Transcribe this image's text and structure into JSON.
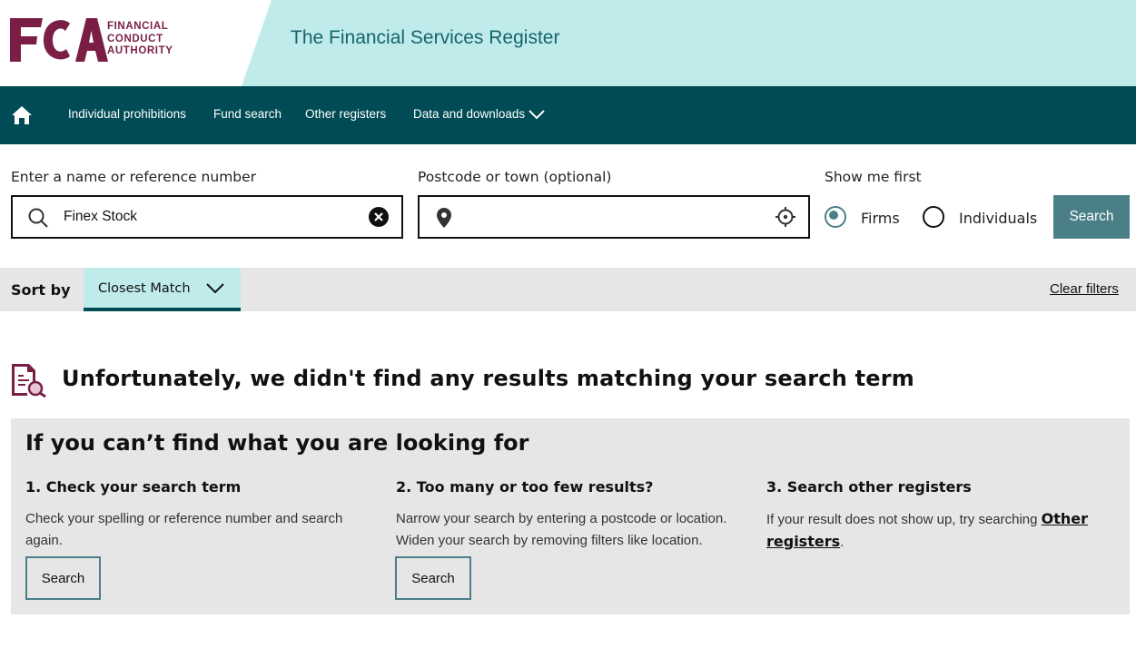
{
  "header": {
    "logo_letters": "FCA",
    "logo_line1": "FINANCIAL",
    "logo_line2": "CONDUCT",
    "logo_line3": "AUTHORITY",
    "title": "The Financial Services Register"
  },
  "nav": {
    "home_icon": "home-icon",
    "items": [
      {
        "label": "Individual prohibitions"
      },
      {
        "label": "Fund search"
      },
      {
        "label": "Other registers"
      },
      {
        "label": "Data and downloads"
      }
    ]
  },
  "search": {
    "name_label": "Enter a name or reference number",
    "name_value": "Finex Stock",
    "location_label": "Postcode or town (optional)",
    "location_value": "",
    "show_first_label": "Show me first",
    "option_firms": "Firms",
    "option_individuals": "Individuals",
    "selected_option": "Firms",
    "button": "Search"
  },
  "sort": {
    "label": "Sort by",
    "selected": "Closest Match",
    "clear_filters": "Clear filters"
  },
  "no_results": {
    "icon": "document-search-icon",
    "message": "Unfortunately, we didn't find any results matching your search term"
  },
  "help": {
    "title": "If you can’t find what you are looking for",
    "col1": {
      "heading": "1. Check your search term",
      "text": "Check your spelling or reference number and search again.",
      "button": "Search"
    },
    "col2": {
      "heading": "2. Too many or too few results?",
      "text": "Narrow your search by entering a postcode or location. Widen your search by removing filters like location.",
      "button": "Search"
    },
    "col3": {
      "heading": "3. Search other registers",
      "text_before": "If your result does not show up, try searching ",
      "link": "Other registers",
      "text_after": "."
    }
  },
  "colors": {
    "brand": "#7a1e46",
    "nav_bg": "#004b55",
    "header_band": "#bfeceb",
    "accent": "#4a7f88",
    "panel_bg": "#e6e6e6"
  }
}
